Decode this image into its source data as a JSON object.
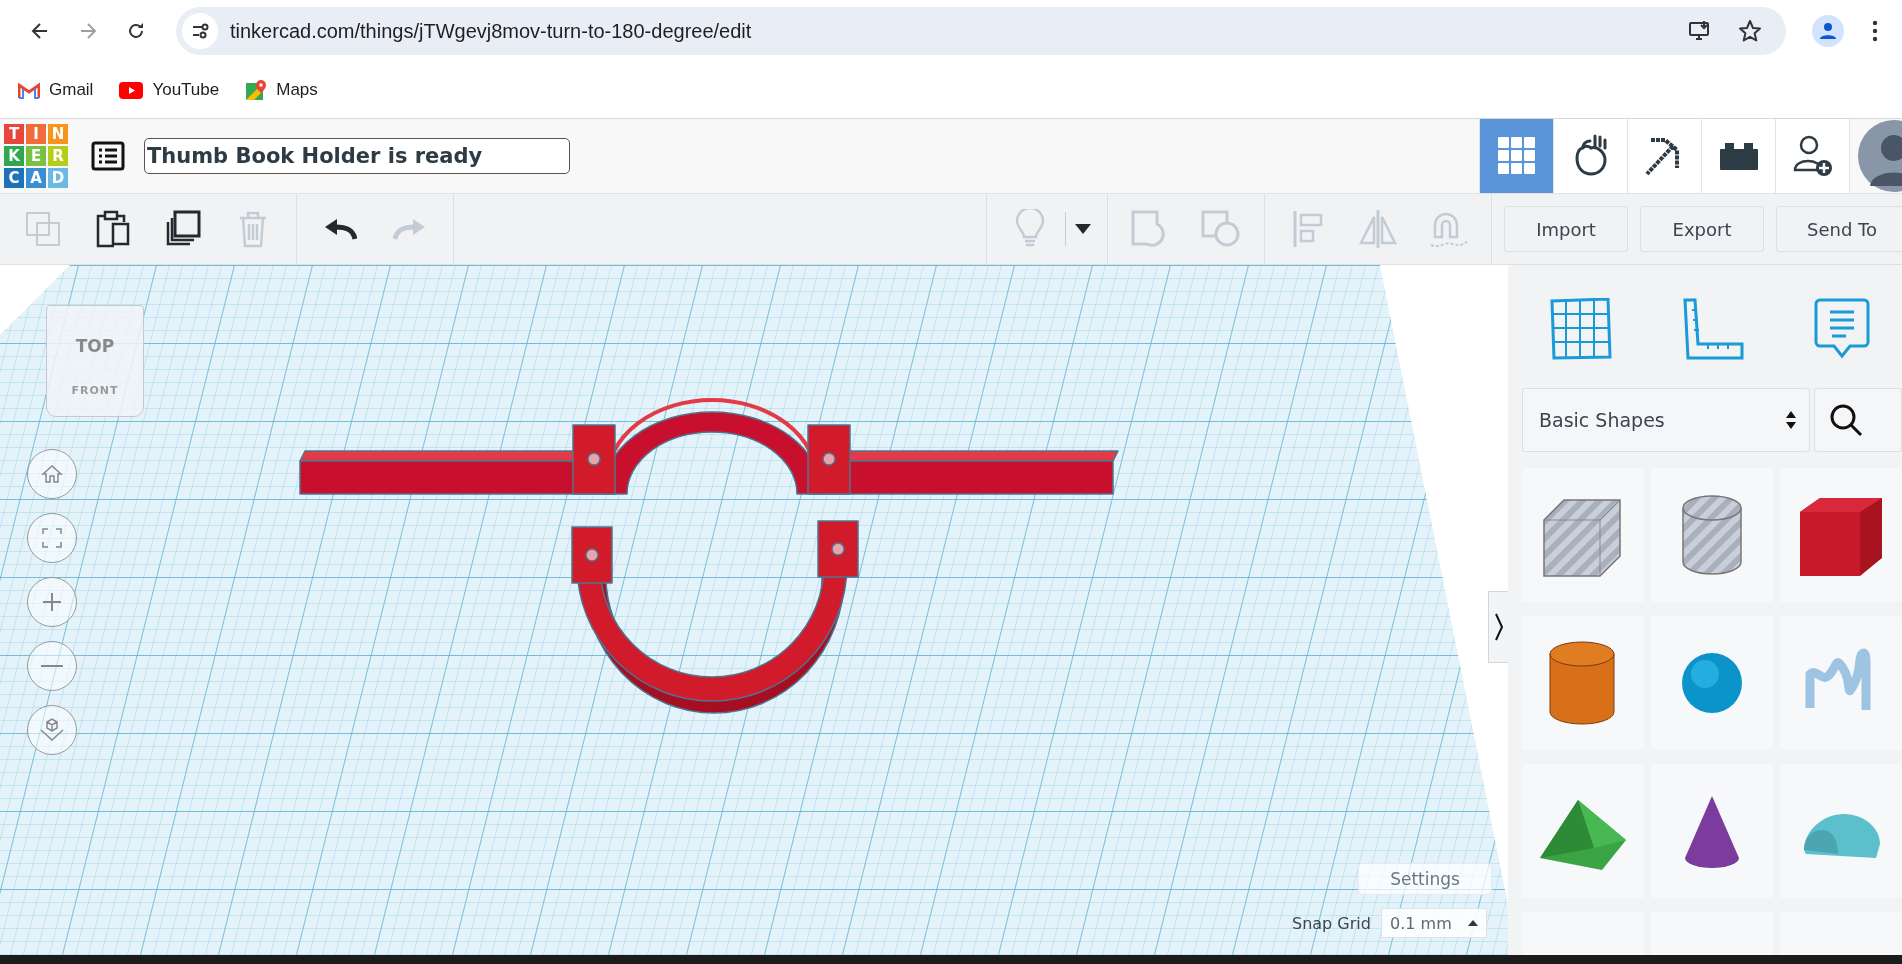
{
  "browser": {
    "back_disabled": false,
    "forward_disabled": true,
    "url": "tinkercad.com/things/jTWgevj8mov-turn-to-180-degree/edit",
    "bookmarks": [
      {
        "kind": "gmail",
        "label": "Gmail"
      },
      {
        "kind": "youtube",
        "label": "YouTube"
      },
      {
        "kind": "maps",
        "label": "Maps"
      }
    ]
  },
  "header": {
    "logo": [
      {
        "letter": "T",
        "color": "#e8453c"
      },
      {
        "letter": "I",
        "color": "#f26b3a"
      },
      {
        "letter": "N",
        "color": "#f7941d"
      },
      {
        "letter": "K",
        "color": "#2fa84f"
      },
      {
        "letter": "E",
        "color": "#7ac143"
      },
      {
        "letter": "R",
        "color": "#b5cc18"
      },
      {
        "letter": "C",
        "color": "#1d72b8"
      },
      {
        "letter": "A",
        "color": "#3b8fd0"
      },
      {
        "letter": "D",
        "color": "#6bb8e0"
      }
    ],
    "title": "Thumb Book Holder is ready",
    "tabs": [
      {
        "kind": "grid",
        "selected": true
      },
      {
        "kind": "blob",
        "selected": false
      },
      {
        "kind": "pickaxe",
        "selected": false
      },
      {
        "kind": "brick",
        "selected": false
      },
      {
        "kind": "add-user",
        "selected": false
      }
    ]
  },
  "toolbar": {
    "left_groups": [
      {
        "tools": [
          {
            "kind": "copy",
            "disabled": true
          },
          {
            "kind": "paste",
            "disabled": false
          },
          {
            "kind": "duplicate",
            "disabled": false
          },
          {
            "kind": "delete",
            "disabled": true
          }
        ]
      },
      {
        "tools": [
          {
            "kind": "undo",
            "disabled": false
          },
          {
            "kind": "redo",
            "disabled": true
          }
        ]
      }
    ],
    "right_groups": [
      {
        "tools": [
          {
            "kind": "bulb",
            "disabled": true
          },
          {
            "kind": "caret",
            "disabled": false
          }
        ]
      },
      {
        "tools": [
          {
            "kind": "group",
            "disabled": true
          },
          {
            "kind": "ungroup",
            "disabled": true
          }
        ]
      },
      {
        "tools": [
          {
            "kind": "align",
            "disabled": true
          },
          {
            "kind": "mirror",
            "disabled": true
          },
          {
            "kind": "magnet",
            "disabled": true
          }
        ]
      }
    ],
    "buttons": [
      "Import",
      "Export",
      "Send To"
    ]
  },
  "view_cube": {
    "top": "TOP",
    "front": "FRONT"
  },
  "workplane": {
    "settings": "Settings",
    "snap_grid_label": "Snap Grid",
    "snap_grid_value": "0.1 mm"
  },
  "panel": {
    "category": "Basic Shapes",
    "shapes": [
      {
        "kind": "box-hole"
      },
      {
        "kind": "cylinder-hole"
      },
      {
        "kind": "box"
      },
      {
        "kind": "cylinder"
      },
      {
        "kind": "sphere"
      },
      {
        "kind": "scribble"
      },
      {
        "kind": "roof"
      },
      {
        "kind": "cone"
      },
      {
        "kind": "round-roof"
      },
      {
        "kind": "cut"
      },
      {
        "kind": "cut"
      },
      {
        "kind": "cut"
      }
    ]
  }
}
